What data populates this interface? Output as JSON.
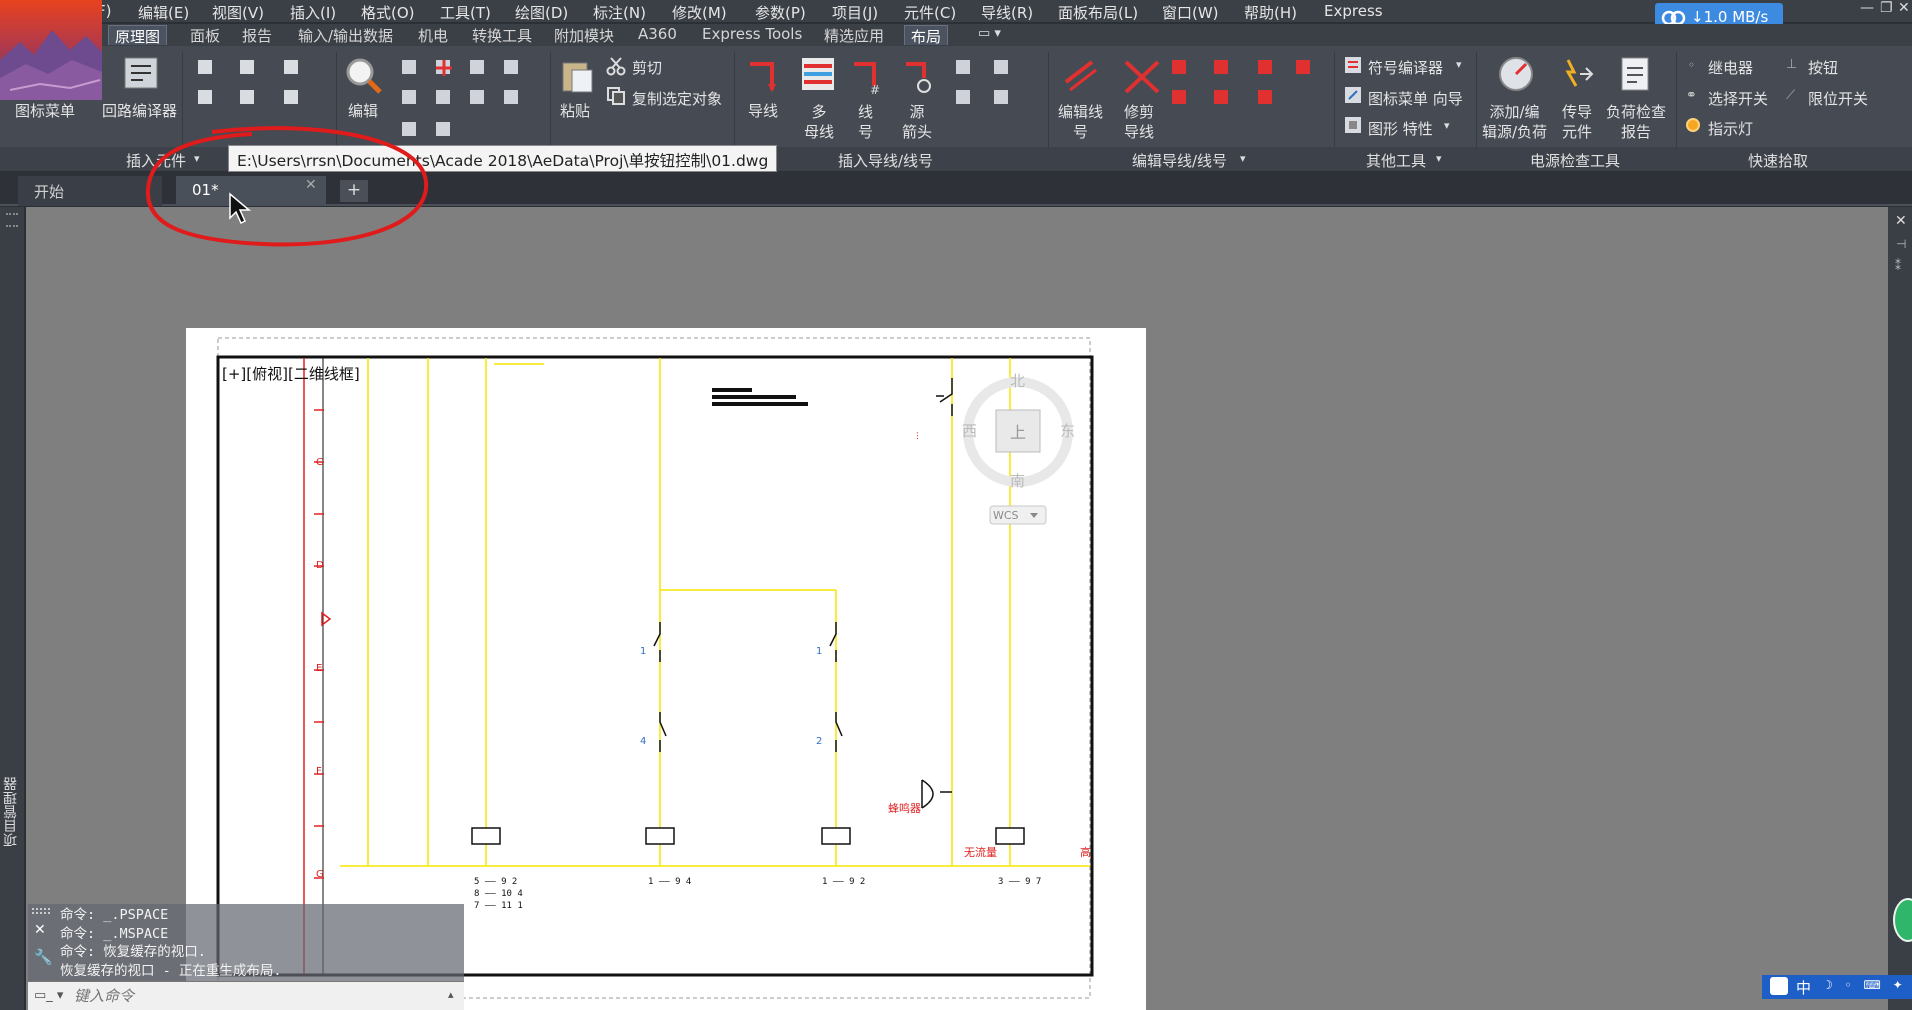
{
  "menubar": {
    "items": [
      "F)",
      "编辑(E)",
      "视图(V)",
      "插入(I)",
      "格式(O)",
      "工具(T)",
      "绘图(D)",
      "标注(N)",
      "修改(M)",
      "参数(P)",
      "项目(J)",
      "元件(C)",
      "导线(R)",
      "面板布局(L)",
      "窗口(W)",
      "帮助(H)",
      "Express"
    ],
    "net_speed": "↓1.0 MB/s"
  },
  "ribbon_tabs": [
    "原理图",
    "面板",
    "报告",
    "输入/输出数据",
    "机电",
    "转换工具",
    "附加模块",
    "A360",
    "Express Tools",
    "精选应用",
    "布局"
  ],
  "ribbon": {
    "icon_menu": "图标菜单",
    "circuit_compiler": "回路编译器",
    "edit": "编辑",
    "paste": "粘贴",
    "cut": "剪切",
    "copy_selected": "复制选定对象",
    "wire": "导线",
    "multi_bus": [
      "多",
      "母线"
    ],
    "wire_number": [
      "线",
      "号"
    ],
    "source_arrow": [
      "源",
      "箭头"
    ],
    "edit_wire_number": [
      "编辑线",
      "号"
    ],
    "trim_wire": [
      "修剪",
      "导线"
    ],
    "symbol_compiler": "符号编译器",
    "icon_menu_wizard": "图标菜单 向导",
    "shape_props": "图形 特性",
    "add_edit_source": [
      "添加/编",
      "辑源/负荷"
    ],
    "conductor": [
      "传导",
      "元件"
    ],
    "load_check": [
      "负荷检查",
      "报告"
    ],
    "relay": "继电器",
    "selector_switch": "选择开关",
    "indicator": "指示灯",
    "pushbutton": "按钮",
    "limit_switch": "限位开关"
  },
  "panel_titles": [
    "插入元件",
    "插入导线/线号",
    "编辑导线/线号",
    "其他工具",
    "电源检查工具",
    "快速拾取"
  ],
  "tooltip_path": "E:\\Users\\rrsn\\Documents\\Acade 2018\\AeData\\Proj\\单按钮控制\\01.dwg",
  "doc_tabs": {
    "start": "开始",
    "current": "01*"
  },
  "left_rail_label": "项目管理器",
  "viewport_label": "[+][俯视][二维线框]",
  "viewcube": {
    "north": "北",
    "south": "南",
    "west": "西",
    "east": "东",
    "top": "上",
    "wcs": "WCS"
  },
  "drawing": {
    "row_letters": [
      "C",
      "D",
      "E",
      "F",
      "G"
    ],
    "contact_labels": [
      "1",
      "4",
      "1",
      "2"
    ],
    "contact_summary": [
      "5 —— 9 2",
      "8 —— 10 4",
      "7 —— 11 1",
      "1 —— 9 4",
      "1 —— 9 2",
      "3 —— 9 7"
    ],
    "buzzer": "蜂鸣器",
    "no_flow": "无流量",
    "stop_note": "高"
  },
  "command": {
    "lines": [
      "命令: _.PSPACE",
      "命令: _.MSPACE",
      "命令: 恢复缓存的视口.",
      "恢复缓存的视口 - 正在重生成布局."
    ],
    "placeholder": "键入命令"
  },
  "ime": {
    "lang": "中"
  },
  "colors": {
    "annotation": "#e01b1b",
    "wire": "#f5e600",
    "rail": "#e02020",
    "accent": "#3d8be0"
  }
}
